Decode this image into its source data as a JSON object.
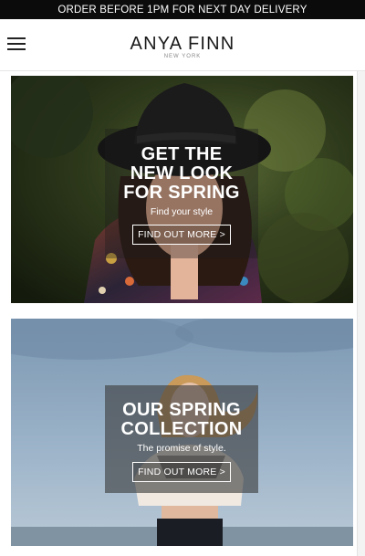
{
  "promo": {
    "text": "ORDER BEFORE 1PM FOR NEXT DAY DELIVERY"
  },
  "header": {
    "logo_main": "ANYA FINN",
    "logo_sub": "NEW YORK"
  },
  "cards": [
    {
      "heading": "GET THE NEW LOOK FOR SPRING",
      "subtitle": "Find your style",
      "cta": "FIND OUT MORE >"
    },
    {
      "heading": "OUR SPRING COLLECTION",
      "subtitle": "The promise of style.",
      "cta": "FIND OUT MORE >"
    }
  ],
  "colors": {
    "promo_bg": "#0b0b0b",
    "overlay": "#2d2d2d",
    "text": "#ffffff"
  }
}
